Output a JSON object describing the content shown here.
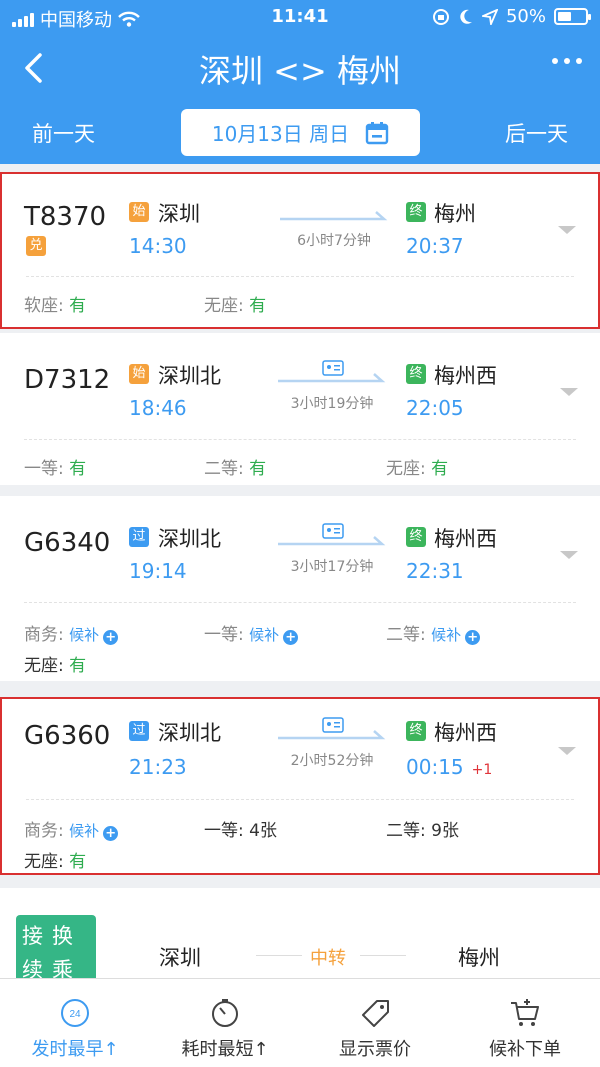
{
  "status_bar": {
    "carrier": "中国移动",
    "time": "11:41",
    "battery": "50%",
    "battery_level": 0.5
  },
  "nav": {
    "title": "深圳 <> 梅州"
  },
  "date_bar": {
    "prev": "前一天",
    "date": "10月13日 周日",
    "next": "后一天"
  },
  "trains": [
    {
      "train_no": "T8370",
      "from_tag": "始",
      "from": "深圳",
      "depart": "14:30",
      "duration": "6小时7分钟",
      "to_tag": "终",
      "to": "梅州",
      "arrive": "20:37",
      "extra_tag": "兑",
      "plus_day": "",
      "seats": [
        {
          "label": "软座:",
          "value": "有"
        },
        {
          "label": "无座:",
          "value": "有"
        }
      ]
    },
    {
      "train_no": "D7312",
      "from_tag": "始",
      "from": "深圳北",
      "depart": "18:46",
      "duration": "3小时19分钟",
      "to_tag": "终",
      "to": "梅州西",
      "arrive": "22:05",
      "plus_day": "",
      "seats": [
        {
          "label": "一等:",
          "value": "有"
        },
        {
          "label": "二等:",
          "value": "有"
        },
        {
          "label": "无座:",
          "value": "有"
        }
      ]
    },
    {
      "train_no": "G6340",
      "from_tag": "过",
      "from": "深圳北",
      "depart": "19:14",
      "duration": "3小时17分钟",
      "to_tag": "终",
      "to": "梅州西",
      "arrive": "22:31",
      "plus_day": "",
      "seats": [
        {
          "label": "商务:",
          "value": "候补"
        },
        {
          "label": "一等:",
          "value": "候补"
        },
        {
          "label": "二等:",
          "value": "候补"
        },
        {
          "label": "无座:",
          "value": "有"
        }
      ]
    },
    {
      "train_no": "G6360",
      "from_tag": "过",
      "from": "深圳北",
      "depart": "21:23",
      "duration": "2小时52分钟",
      "to_tag": "终",
      "to": "梅州西",
      "arrive": "00:15",
      "plus_day": "+1",
      "seats": [
        {
          "label": "商务:",
          "value": "候补"
        },
        {
          "label": "一等:",
          "value": "4张"
        },
        {
          "label": "二等:",
          "value": "9张"
        },
        {
          "label": "无座:",
          "value": "有"
        }
      ]
    }
  ],
  "transfer": {
    "badge": "接换续乘",
    "from": "深圳",
    "middle": "中转",
    "to": "梅州"
  },
  "bottom_tabs": [
    {
      "label": "发时最早↑",
      "icon": "clock-24-icon"
    },
    {
      "label": "耗时最短↑",
      "icon": "timer-icon"
    },
    {
      "label": "显示票价",
      "icon": "price-tag-icon"
    },
    {
      "label": "候补下单",
      "icon": "cart-plus-icon"
    }
  ],
  "colors": {
    "header": "#3d9bf1",
    "highlight_border": "#d93030",
    "available": "#2eac4f",
    "time": "#3d9bf1"
  }
}
